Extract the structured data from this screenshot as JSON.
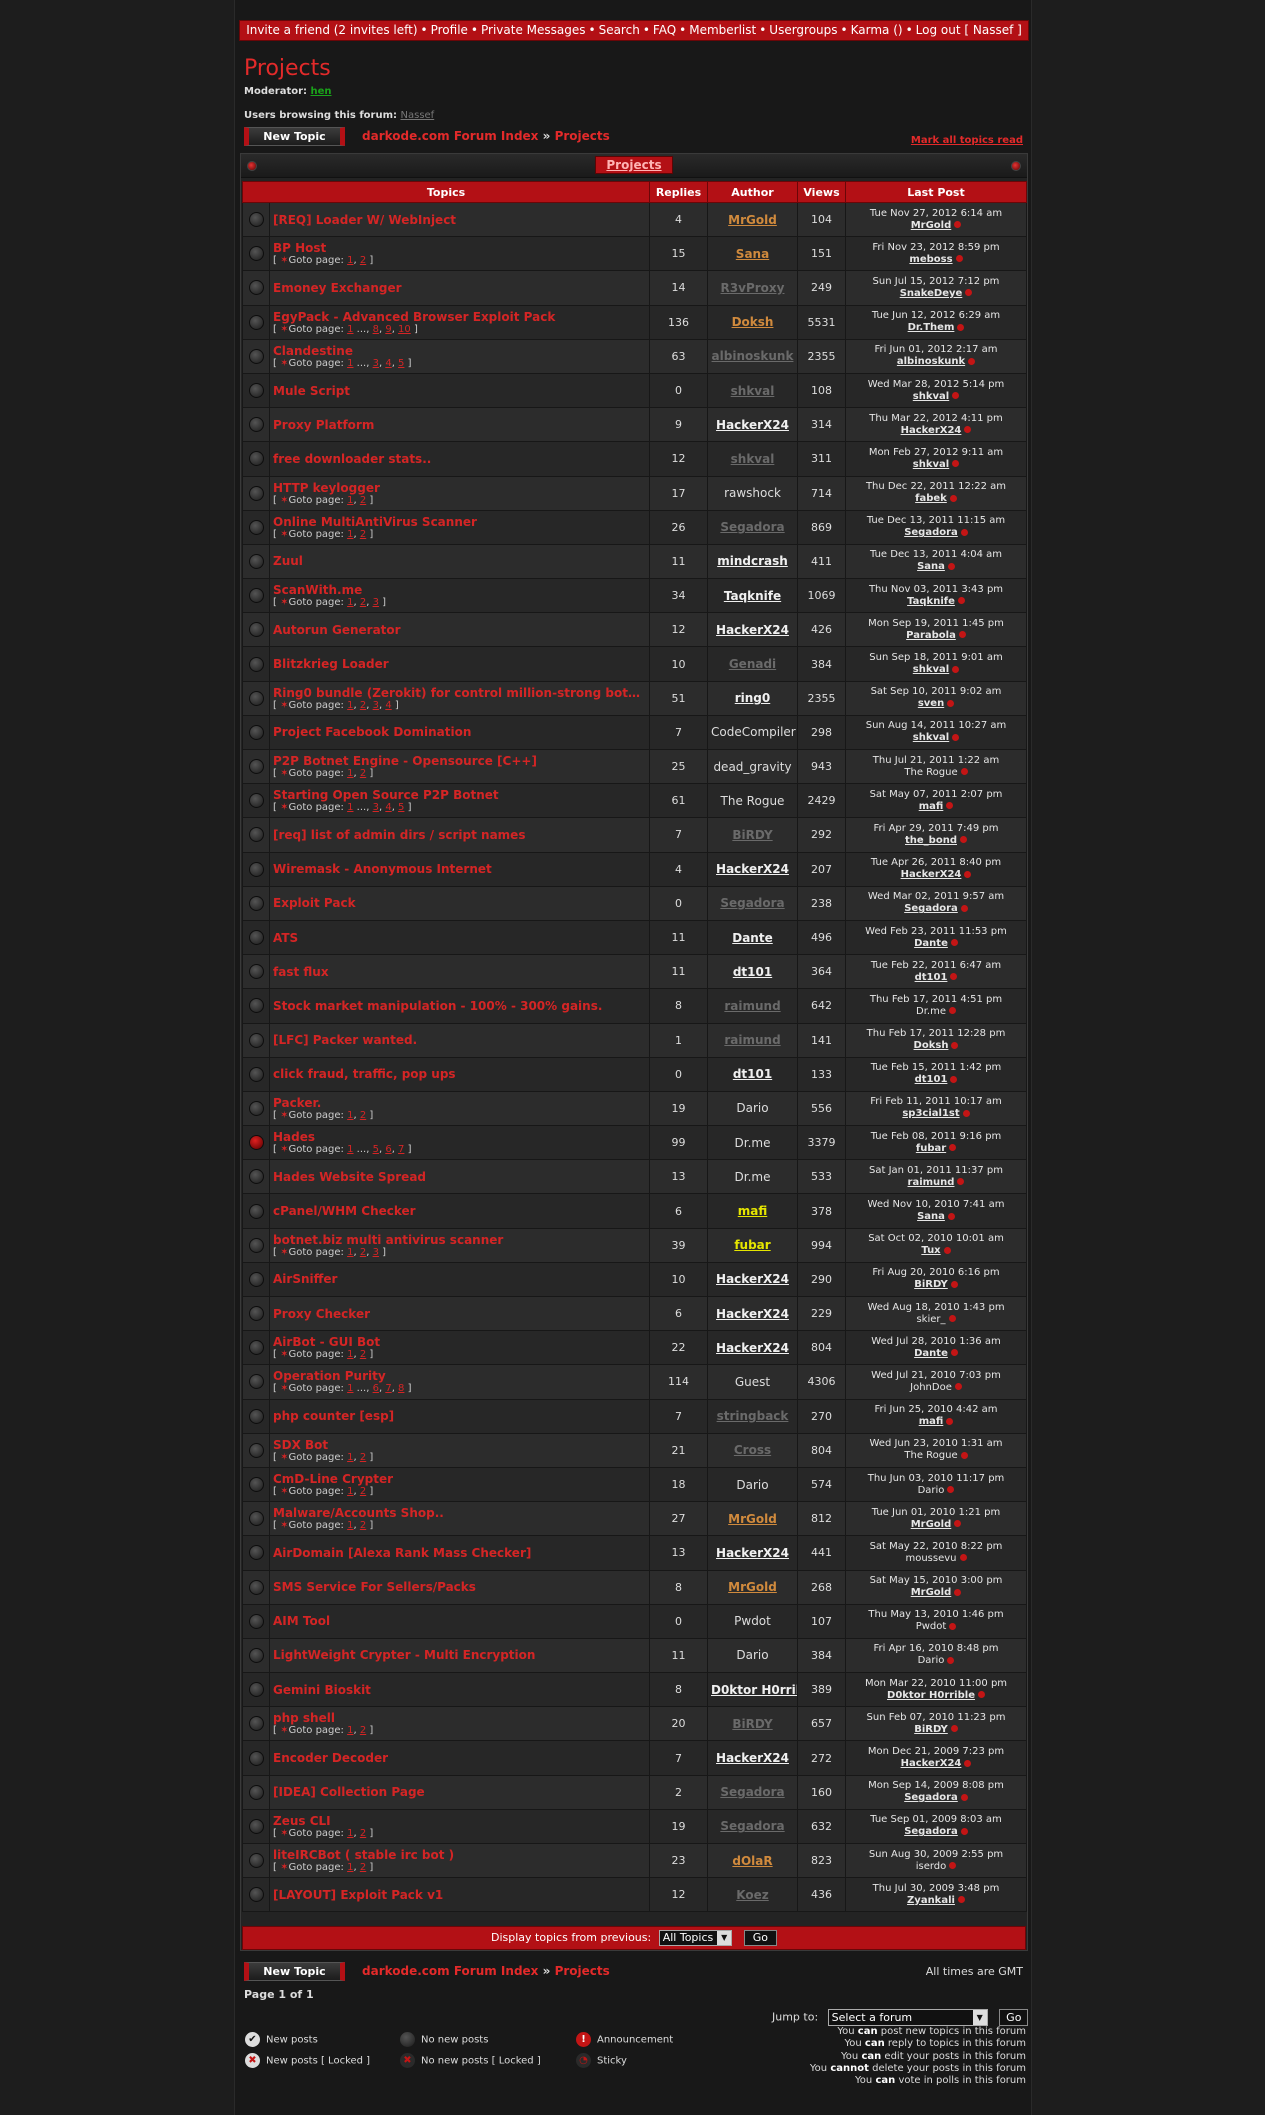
{
  "nav": {
    "items": [
      "Invite a friend (2 invites left)",
      "Profile",
      "Private Messages",
      "Search",
      "FAQ",
      "Memberlist",
      "Usergroups",
      "Karma ()",
      "Log out [ Nassef ]"
    ],
    "separator": "•"
  },
  "forum": {
    "title": "Projects",
    "moderator_label": "Moderator:",
    "moderator": "hen",
    "browsing_label": "Users browsing this forum:",
    "browsing_user": "Nassef",
    "new_topic": "New Topic",
    "crumb_root": "darkode.com Forum Index",
    "crumb_sep": "»",
    "crumb_current": "Projects",
    "mark_all": "Mark all topics read",
    "box_title": "Projects"
  },
  "columns": [
    "Topics",
    "Replies",
    "Author",
    "Views",
    "Last Post"
  ],
  "goto_label": "Goto page:",
  "topics": [
    {
      "title": "[REQ] Loader W/ WebInject",
      "pages": [],
      "replies": "4",
      "author": "MrGold",
      "astyle": "gold",
      "views": "104",
      "date": "Tue Nov 27, 2012 6:14 am",
      "last": "MrGold",
      "lstyle": "u"
    },
    {
      "title": "BP Host",
      "pages": [
        "1",
        "2"
      ],
      "replies": "15",
      "author": "Sana",
      "astyle": "gold",
      "views": "151",
      "date": "Fri Nov 23, 2012 8:59 pm",
      "last": "meboss",
      "lstyle": "u"
    },
    {
      "title": "Emoney Exchanger",
      "pages": [],
      "replies": "14",
      "author": "R3vProxy",
      "astyle": "grey",
      "views": "249",
      "date": "Sun Jul 15, 2012 7:12 pm",
      "last": "SnakeDeye",
      "lstyle": "u"
    },
    {
      "title": "EgyPack - Advanced Browser Exploit Pack",
      "pages": [
        "1",
        "...",
        "8",
        "9",
        "10"
      ],
      "replies": "136",
      "author": "Doksh",
      "astyle": "gold",
      "views": "5531",
      "date": "Tue Jun 12, 2012 6:29 am",
      "last": "Dr.Them",
      "lstyle": "u"
    },
    {
      "title": "Clandestine",
      "pages": [
        "1",
        "...",
        "3",
        "4",
        "5"
      ],
      "replies": "63",
      "author": "albinoskunk",
      "astyle": "grey",
      "views": "2355",
      "date": "Fri Jun 01, 2012 2:17 am",
      "last": "albinoskunk",
      "lstyle": "u"
    },
    {
      "title": "Mule Script",
      "pages": [],
      "replies": "0",
      "author": "shkval",
      "astyle": "grey",
      "views": "108",
      "date": "Wed Mar 28, 2012 5:14 pm",
      "last": "shkval",
      "lstyle": "u"
    },
    {
      "title": "Proxy Platform",
      "pages": [],
      "replies": "9",
      "author": "HackerX24",
      "astyle": "white",
      "views": "314",
      "date": "Thu Mar 22, 2012 4:11 pm",
      "last": "HackerX24",
      "lstyle": "u"
    },
    {
      "title": "free downloader stats..",
      "pages": [],
      "replies": "12",
      "author": "shkval",
      "astyle": "grey",
      "views": "311",
      "date": "Mon Feb 27, 2012 9:11 am",
      "last": "shkval",
      "lstyle": "u"
    },
    {
      "title": "HTTP keylogger",
      "pages": [
        "1",
        "2"
      ],
      "replies": "17",
      "author": "rawshock",
      "astyle": "plain",
      "views": "714",
      "date": "Thu Dec 22, 2011 12:22 am",
      "last": "fabek",
      "lstyle": "u"
    },
    {
      "title": "Online MultiAntiVirus Scanner",
      "pages": [
        "1",
        "2"
      ],
      "replies": "26",
      "author": "Segadora",
      "astyle": "grey",
      "views": "869",
      "date": "Tue Dec 13, 2011 11:15 am",
      "last": "Segadora",
      "lstyle": "u"
    },
    {
      "title": "Zuul",
      "pages": [],
      "replies": "11",
      "author": "mindcrash",
      "astyle": "white",
      "views": "411",
      "date": "Tue Dec 13, 2011 4:04 am",
      "last": "Sana",
      "lstyle": "u"
    },
    {
      "title": "ScanWith.me",
      "pages": [
        "1",
        "2",
        "3"
      ],
      "replies": "34",
      "author": "Taqknife",
      "astyle": "white",
      "views": "1069",
      "date": "Thu Nov 03, 2011 3:43 pm",
      "last": "Taqknife",
      "lstyle": "u"
    },
    {
      "title": "Autorun Generator",
      "pages": [],
      "replies": "12",
      "author": "HackerX24",
      "astyle": "white",
      "views": "426",
      "date": "Mon Sep 19, 2011 1:45 pm",
      "last": "Parabola",
      "lstyle": "u"
    },
    {
      "title": "Blitzkrieg Loader",
      "pages": [],
      "replies": "10",
      "author": "Genadi",
      "astyle": "grey",
      "views": "384",
      "date": "Sun Sep 18, 2011 9:01 am",
      "last": "shkval",
      "lstyle": "u"
    },
    {
      "title": "Ring0 bundle (Zerokit) for control million-strong botnet",
      "pages": [
        "1",
        "2",
        "3",
        "4"
      ],
      "replies": "51",
      "author": "ring0",
      "astyle": "white",
      "views": "2355",
      "date": "Sat Sep 10, 2011 9:02 am",
      "last": "sven",
      "lstyle": "u"
    },
    {
      "title": "Project Facebook Domination",
      "pages": [],
      "replies": "7",
      "author": "CodeCompiler",
      "astyle": "plain",
      "views": "298",
      "date": "Sun Aug 14, 2011 10:27 am",
      "last": "shkval",
      "lstyle": "u"
    },
    {
      "title": "P2P Botnet Engine - Opensource [C++]",
      "pages": [
        "1",
        "2"
      ],
      "replies": "25",
      "author": "dead_gravity",
      "astyle": "plain",
      "views": "943",
      "date": "Thu Jul 21, 2011 1:22 am",
      "last": "The Rogue",
      "lstyle": "plain"
    },
    {
      "title": "Starting Open Source P2P Botnet",
      "pages": [
        "1",
        "...",
        "3",
        "4",
        "5"
      ],
      "replies": "61",
      "author": "The Rogue",
      "astyle": "plain",
      "views": "2429",
      "date": "Sat May 07, 2011 2:07 pm",
      "last": "mafi",
      "lstyle": "u"
    },
    {
      "title": "[req] list of admin dirs / script names",
      "pages": [],
      "replies": "7",
      "author": "BiRDY",
      "astyle": "grey",
      "views": "292",
      "date": "Fri Apr 29, 2011 7:49 pm",
      "last": "the_bond",
      "lstyle": "u"
    },
    {
      "title": "Wiremask - Anonymous Internet",
      "pages": [],
      "replies": "4",
      "author": "HackerX24",
      "astyle": "white",
      "views": "207",
      "date": "Tue Apr 26, 2011 8:40 pm",
      "last": "HackerX24",
      "lstyle": "u"
    },
    {
      "title": "Exploit Pack",
      "pages": [],
      "replies": "0",
      "author": "Segadora",
      "astyle": "grey",
      "views": "238",
      "date": "Wed Mar 02, 2011 9:57 am",
      "last": "Segadora",
      "lstyle": "u"
    },
    {
      "title": "ATS",
      "pages": [],
      "replies": "11",
      "author": "Dante",
      "astyle": "white",
      "views": "496",
      "date": "Wed Feb 23, 2011 11:53 pm",
      "last": "Dante",
      "lstyle": "u"
    },
    {
      "title": "fast flux",
      "pages": [],
      "replies": "11",
      "author": "dt101",
      "astyle": "white",
      "views": "364",
      "date": "Tue Feb 22, 2011 6:47 am",
      "last": "dt101",
      "lstyle": "u"
    },
    {
      "title": "Stock market manipulation - 100% - 300% gains.",
      "pages": [],
      "replies": "8",
      "author": "raimund",
      "astyle": "grey",
      "views": "642",
      "date": "Thu Feb 17, 2011 4:51 pm",
      "last": "Dr.me",
      "lstyle": "plain"
    },
    {
      "title": "[LFC] Packer wanted.",
      "pages": [],
      "replies": "1",
      "author": "raimund",
      "astyle": "grey",
      "views": "141",
      "date": "Thu Feb 17, 2011 12:28 pm",
      "last": "Doksh",
      "lstyle": "u"
    },
    {
      "title": "click fraud, traffic, pop ups",
      "pages": [],
      "replies": "0",
      "author": "dt101",
      "astyle": "white",
      "views": "133",
      "date": "Tue Feb 15, 2011 1:42 pm",
      "last": "dt101",
      "lstyle": "u"
    },
    {
      "title": "Packer.",
      "pages": [
        "1",
        "2"
      ],
      "replies": "19",
      "author": "Dario",
      "astyle": "plain",
      "views": "556",
      "date": "Fri Feb 11, 2011 10:17 am",
      "last": "sp3cial1st",
      "lstyle": "u"
    },
    {
      "title": "Hades",
      "pages": [
        "1",
        "...",
        "5",
        "6",
        "7"
      ],
      "replies": "99",
      "author": "Dr.me",
      "astyle": "plain",
      "views": "3379",
      "date": "Tue Feb 08, 2011 9:16 pm",
      "last": "fubar",
      "lstyle": "u",
      "hot": true
    },
    {
      "title": "Hades Website Spread",
      "pages": [],
      "replies": "13",
      "author": "Dr.me",
      "astyle": "plain",
      "views": "533",
      "date": "Sat Jan 01, 2011 11:37 pm",
      "last": "raimund",
      "lstyle": "u"
    },
    {
      "title": "cPanel/WHM Checker",
      "pages": [],
      "replies": "6",
      "author": "mafi",
      "astyle": "yellow",
      "views": "378",
      "date": "Wed Nov 10, 2010 7:41 am",
      "last": "Sana",
      "lstyle": "u"
    },
    {
      "title": "botnet.biz multi antivirus scanner",
      "pages": [
        "1",
        "2",
        "3"
      ],
      "replies": "39",
      "author": "fubar",
      "astyle": "yellow",
      "views": "994",
      "date": "Sat Oct 02, 2010 10:01 am",
      "last": "Tux",
      "lstyle": "u"
    },
    {
      "title": "AirSniffer",
      "pages": [],
      "replies": "10",
      "author": "HackerX24",
      "astyle": "white",
      "views": "290",
      "date": "Fri Aug 20, 2010 6:16 pm",
      "last": "BiRDY",
      "lstyle": "u"
    },
    {
      "title": "Proxy Checker",
      "pages": [],
      "replies": "6",
      "author": "HackerX24",
      "astyle": "white",
      "views": "229",
      "date": "Wed Aug 18, 2010 1:43 pm",
      "last": "skier_",
      "lstyle": "plain"
    },
    {
      "title": "AirBot - GUI Bot",
      "pages": [
        "1",
        "2"
      ],
      "replies": "22",
      "author": "HackerX24",
      "astyle": "white",
      "views": "804",
      "date": "Wed Jul 28, 2010 1:36 am",
      "last": "Dante",
      "lstyle": "u"
    },
    {
      "title": "Operation Purity",
      "pages": [
        "1",
        "...",
        "6",
        "7",
        "8"
      ],
      "replies": "114",
      "author": "Guest",
      "astyle": "plain",
      "views": "4306",
      "date": "Wed Jul 21, 2010 7:03 pm",
      "last": "JohnDoe",
      "lstyle": "plain"
    },
    {
      "title": "php counter [esp]",
      "pages": [],
      "replies": "7",
      "author": "stringback",
      "astyle": "grey",
      "views": "270",
      "date": "Fri Jun 25, 2010 4:42 am",
      "last": "mafi",
      "lstyle": "u"
    },
    {
      "title": "SDX Bot",
      "pages": [
        "1",
        "2"
      ],
      "replies": "21",
      "author": "Cross",
      "astyle": "grey",
      "views": "804",
      "date": "Wed Jun 23, 2010 1:31 am",
      "last": "The Rogue",
      "lstyle": "plain"
    },
    {
      "title": "CmD-Line Crypter",
      "pages": [
        "1",
        "2"
      ],
      "replies": "18",
      "author": "Dario",
      "astyle": "plain",
      "views": "574",
      "date": "Thu Jun 03, 2010 11:17 pm",
      "last": "Dario",
      "lstyle": "plain"
    },
    {
      "title": "Malware/Accounts Shop..",
      "pages": [
        "1",
        "2"
      ],
      "replies": "27",
      "author": "MrGold",
      "astyle": "gold",
      "views": "812",
      "date": "Tue Jun 01, 2010 1:21 pm",
      "last": "MrGold",
      "lstyle": "u"
    },
    {
      "title": "AirDomain [Alexa Rank Mass Checker]",
      "pages": [],
      "replies": "13",
      "author": "HackerX24",
      "astyle": "white",
      "views": "441",
      "date": "Sat May 22, 2010 8:22 pm",
      "last": "moussevu",
      "lstyle": "plain"
    },
    {
      "title": "SMS Service For Sellers/Packs",
      "pages": [],
      "replies": "8",
      "author": "MrGold",
      "astyle": "gold",
      "views": "268",
      "date": "Sat May 15, 2010 3:00 pm",
      "last": "MrGold",
      "lstyle": "u"
    },
    {
      "title": "AIM Tool",
      "pages": [],
      "replies": "0",
      "author": "Pwdot",
      "astyle": "plain",
      "views": "107",
      "date": "Thu May 13, 2010 1:46 pm",
      "last": "Pwdot",
      "lstyle": "plain"
    },
    {
      "title": "LightWeight Crypter - Multi Encryption",
      "pages": [],
      "replies": "11",
      "author": "Dario",
      "astyle": "plain",
      "views": "384",
      "date": "Fri Apr 16, 2010 8:48 pm",
      "last": "Dario",
      "lstyle": "plain"
    },
    {
      "title": "Gemini Bioskit",
      "pages": [],
      "replies": "8",
      "author": "D0ktor H0rrible",
      "astyle": "white",
      "views": "389",
      "date": "Mon Mar 22, 2010 11:00 pm",
      "last": "D0ktor H0rrible",
      "lstyle": "u"
    },
    {
      "title": "php shell",
      "pages": [
        "1",
        "2"
      ],
      "replies": "20",
      "author": "BiRDY",
      "astyle": "grey",
      "views": "657",
      "date": "Sun Feb 07, 2010 11:23 pm",
      "last": "BiRDY",
      "lstyle": "u"
    },
    {
      "title": "Encoder Decoder",
      "pages": [],
      "replies": "7",
      "author": "HackerX24",
      "astyle": "white",
      "views": "272",
      "date": "Mon Dec 21, 2009 7:23 pm",
      "last": "HackerX24",
      "lstyle": "u"
    },
    {
      "title": "[IDEA] Collection Page",
      "pages": [],
      "replies": "2",
      "author": "Segadora",
      "astyle": "grey",
      "views": "160",
      "date": "Mon Sep 14, 2009 8:08 pm",
      "last": "Segadora",
      "lstyle": "u"
    },
    {
      "title": "Zeus CLI",
      "pages": [
        "1",
        "2"
      ],
      "replies": "19",
      "author": "Segadora",
      "astyle": "grey",
      "views": "632",
      "date": "Tue Sep 01, 2009 8:03 am",
      "last": "Segadora",
      "lstyle": "u"
    },
    {
      "title": "liteIRCBot ( stable irc bot )",
      "pages": [
        "1",
        "2"
      ],
      "replies": "23",
      "author": "dOlaR",
      "astyle": "gold",
      "views": "823",
      "date": "Sun Aug 30, 2009 2:55 pm",
      "last": "iserdo",
      "lstyle": "plain"
    },
    {
      "title": "[LAYOUT] Exploit Pack v1",
      "pages": [],
      "replies": "12",
      "author": "Koez",
      "astyle": "grey",
      "views": "436",
      "date": "Thu Jul 30, 2009 3:48 pm",
      "last": "Zyankali",
      "lstyle": "u"
    }
  ],
  "footer": {
    "display_label": "Display topics from previous:",
    "display_value": "All Topics",
    "go": "Go",
    "timezone": "All times are GMT",
    "page_of": "Page 1 of 1",
    "jump_label": "Jump to:",
    "jump_value": "Select a forum",
    "jump_go": "Go"
  },
  "permissions": [
    {
      "pre": "You",
      "b": "can",
      "post": "post new topics in this forum"
    },
    {
      "pre": "You",
      "b": "can",
      "post": "reply to topics in this forum"
    },
    {
      "pre": "You",
      "b": "can",
      "post": "edit your posts in this forum"
    },
    {
      "pre": "You",
      "b": "cannot",
      "post": "delete your posts in this forum"
    },
    {
      "pre": "You",
      "b": "can",
      "post": "vote in polls in this forum"
    }
  ],
  "legend": {
    "new_posts": "New posts",
    "no_new_posts": "No new posts",
    "announcement": "Announcement",
    "new_locked": "New posts [ Locked ]",
    "no_new_locked": "No new posts [ Locked ]",
    "sticky": "Sticky"
  },
  "colors": {
    "accent": "#b31015",
    "title_red": "#e32a2a",
    "bg": "#1d1d1d"
  }
}
